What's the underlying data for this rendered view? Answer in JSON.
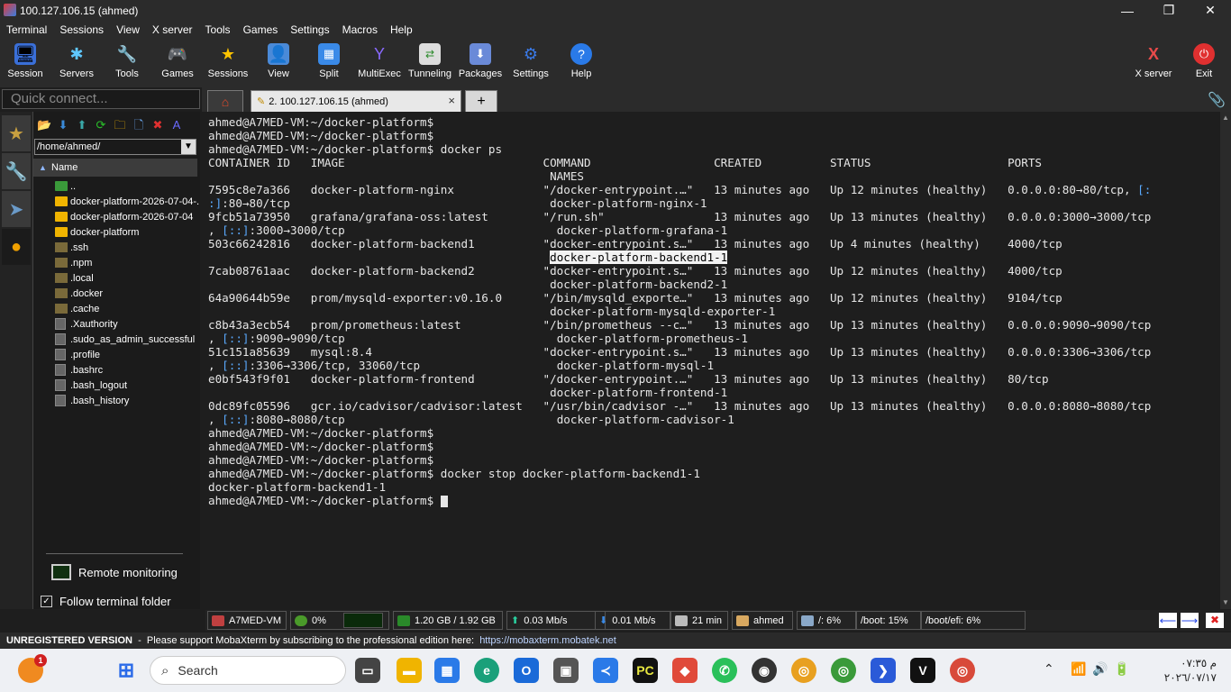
{
  "window": {
    "title": "100.127.106.15 (ahmed)",
    "controls": [
      "—",
      "❐",
      "✕"
    ]
  },
  "menu": [
    "Terminal",
    "Sessions",
    "View",
    "X server",
    "Tools",
    "Games",
    "Settings",
    "Macros",
    "Help"
  ],
  "toolbar": {
    "session": "Session",
    "servers": "Servers",
    "tools": "Tools",
    "games": "Games",
    "sessions": "Sessions",
    "view": "View",
    "split": "Split",
    "multiexec": "MultiExec",
    "tunneling": "Tunneling",
    "packages": "Packages",
    "settings": "Settings",
    "help": "Help",
    "xserver": "X server",
    "exit": "Exit"
  },
  "quick_connect": {
    "placeholder": "Quick connect..."
  },
  "tabs": {
    "ssh_label": "2. 100.127.106.15 (ahmed)",
    "close": "×",
    "add": "+"
  },
  "filebrowser": {
    "path": "/home/ahmed/",
    "column": "Name",
    "entries": [
      {
        "name": "..",
        "kind": "up"
      },
      {
        "name": "docker-platform-2026-07-04-...",
        "kind": "folder"
      },
      {
        "name": "docker-platform-2026-07-04",
        "kind": "folder"
      },
      {
        "name": "docker-platform",
        "kind": "folder"
      },
      {
        "name": ".ssh",
        "kind": "dotfolder"
      },
      {
        "name": ".npm",
        "kind": "dotfolder"
      },
      {
        "name": ".local",
        "kind": "dotfolder"
      },
      {
        "name": ".docker",
        "kind": "dotfolder"
      },
      {
        "name": ".cache",
        "kind": "dotfolder"
      },
      {
        "name": ".Xauthority",
        "kind": "file"
      },
      {
        "name": ".sudo_as_admin_successful",
        "kind": "file"
      },
      {
        "name": ".profile",
        "kind": "file"
      },
      {
        "name": ".bashrc",
        "kind": "file"
      },
      {
        "name": ".bash_logout",
        "kind": "file"
      },
      {
        "name": ".bash_history",
        "kind": "file"
      }
    ],
    "remote_monitoring": "Remote monitoring",
    "follow_folder": "Follow terminal folder",
    "follow_checked": "✓"
  },
  "terminal": {
    "lines": [
      "ahmed@A7MED-VM:~/docker-platform$",
      "ahmed@A7MED-VM:~/docker-platform$",
      "ahmed@A7MED-VM:~/docker-platform$ docker ps",
      "CONTAINER ID   IMAGE                             COMMAND                  CREATED          STATUS                    PORTS",
      "                                                  NAMES",
      "7595c8e7a366   docker-platform-nginx             \"/docker-entrypoint.…\"   13 minutes ago   Up 12 minutes (healthy)   0.0.0.0:80→80/tcp, [:",
      ":]:80→80/tcp                                      docker-platform-nginx-1",
      "9fcb51a73950   grafana/grafana-oss:latest        \"/run.sh\"                13 minutes ago   Up 13 minutes (healthy)   0.0.0.0:3000→3000/tcp",
      ", [::]:3000→3000/tcp                               docker-platform-grafana-1",
      "503c66242816   docker-platform-backend1          \"docker-entrypoint.s…\"   13 minutes ago   Up 4 minutes (healthy)    4000/tcp",
      "                                                  docker-platform-backend1-1",
      "7cab08761aac   docker-platform-backend2          \"docker-entrypoint.s…\"   13 minutes ago   Up 12 minutes (healthy)   4000/tcp",
      "                                                  docker-platform-backend2-1",
      "64a90644b59e   prom/mysqld-exporter:v0.16.0      \"/bin/mysqld_exporte…\"   13 minutes ago   Up 12 minutes (healthy)   9104/tcp",
      "                                                  docker-platform-mysqld-exporter-1",
      "c8b43a3ecb54   prom/prometheus:latest            \"/bin/prometheus --c…\"   13 minutes ago   Up 13 minutes (healthy)   0.0.0.0:9090→9090/tcp",
      ", [::]:9090→9090/tcp                               docker-platform-prometheus-1",
      "51c151a85639   mysql:8.4                         \"docker-entrypoint.s…\"   13 minutes ago   Up 13 minutes (healthy)   0.0.0.0:3306→3306/tcp",
      ", [::]:3306→3306/tcp, 33060/tcp                    docker-platform-mysql-1",
      "e0bf543f9f01   docker-platform-frontend          \"/docker-entrypoint.…\"   13 minutes ago   Up 13 minutes (healthy)   80/tcp",
      "                                                  docker-platform-frontend-1",
      "0dc89fc05596   gcr.io/cadvisor/cadvisor:latest   \"/usr/bin/cadvisor -…\"   13 minutes ago   Up 13 minutes (healthy)   0.0.0.0:8080→8080/tcp",
      ", [::]:8080→8080/tcp                               docker-platform-cadvisor-1",
      "ahmed@A7MED-VM:~/docker-platform$",
      "ahmed@A7MED-VM:~/docker-platform$",
      "ahmed@A7MED-VM:~/docker-platform$",
      "ahmed@A7MED-VM:~/docker-platform$ docker stop docker-platform-backend1-1",
      "docker-platform-backend1-1",
      "ahmed@A7MED-VM:~/docker-platform$ "
    ]
  },
  "statusbar": {
    "host": "A7MED-VM",
    "cpu": "0%",
    "memory": "1.20 GB / 1.92 GB",
    "upload": "0.03 Mb/s",
    "download": "0.01 Mb/s",
    "uptime": "21 min",
    "user": "ahmed",
    "disk_root": "/: 6%",
    "disk_boot": "/boot: 15%",
    "disk_efi": "/boot/efi: 6%"
  },
  "unregistered": {
    "bold": "UNREGISTERED VERSION",
    "text": "  -  Please support MobaXterm by subscribing to the professional edition here:  ",
    "link": "https://mobaxterm.mobatek.net"
  },
  "taskbar": {
    "search": "Search",
    "badge": "1",
    "time": "م ٠٧:٣٥",
    "date": "٢٠٢٦/٠٧/١٧"
  },
  "colors": {
    "terminal_bg": "#1e1e1e",
    "cyan": "#5aaaff",
    "titlebar": "#2b2b2b"
  }
}
